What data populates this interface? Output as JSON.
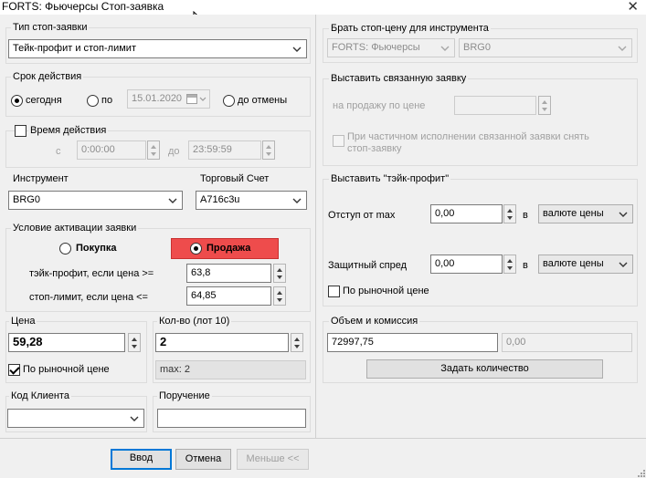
{
  "window": {
    "title": "FORTS: Фьючерсы Стоп-заявка",
    "close_glyph": "✕"
  },
  "order_type": {
    "legend": "Тип стоп-заявки",
    "value": "Тейк-профит и стоп-лимит"
  },
  "validity": {
    "legend": "Срок действия",
    "today_label": "сегодня",
    "until_label": "по",
    "date_value": "15.01.2020",
    "until_cancel_label": "до отмены",
    "selected": "today"
  },
  "time_window": {
    "legend": "Время действия",
    "checked": false,
    "from_label": "с",
    "from_value": "0:00:00",
    "to_label": "до",
    "to_value": "23:59:59"
  },
  "instrument": {
    "legend": "Инструмент",
    "value": "BRG0"
  },
  "account": {
    "legend": "Торговый Счет",
    "value": "A716c3u"
  },
  "activation": {
    "legend": "Условие активации заявки",
    "buy_label": "Покупка",
    "sell_label": "Продажа",
    "selected": "sell",
    "take_profit_label": "тэйк-профит, если цена >=",
    "take_profit_value": "63,8",
    "stop_limit_label": "стоп-лимит, если цена <=",
    "stop_limit_value": "64,85"
  },
  "price": {
    "legend": "Цена",
    "value": "59,28",
    "market_label": "По рыночной цене",
    "market_checked": true
  },
  "quantity": {
    "legend": "Кол-во (лот 10)",
    "value": "2",
    "max_text": "max: 2"
  },
  "client_code": {
    "legend": "Код Клиента",
    "value": ""
  },
  "instruction": {
    "legend": "Поручение",
    "value": ""
  },
  "stop_price_source": {
    "legend": "Брать стоп-цену для инструмента",
    "class_value": "FORTS: Фьючерсы",
    "instrument_value": "BRG0"
  },
  "linked_order": {
    "legend": "Выставить связанную заявку",
    "sell_price_label": "на продажу по цене",
    "sell_price_value": "",
    "partial_label_line1": "При частичном исполнении связанной заявки снять",
    "partial_label_line2": "стоп-заявку"
  },
  "take_profit": {
    "legend": "Выставить \"тэйк-профит\"",
    "offset_label": "Отступ от max",
    "offset_value": "0,00",
    "offset_unit_prefix": "в",
    "offset_unit": "валюте цены",
    "spread_label": "Защитный спред",
    "spread_value": "0,00",
    "spread_unit_prefix": "в",
    "spread_unit": "валюте цены",
    "market_label": "По рыночной цене",
    "market_checked": false
  },
  "volume": {
    "legend": "Объем и комиссия",
    "volume_value": "72997,75",
    "commission_value": "0,00",
    "set_quantity_label": "Задать количество"
  },
  "buttons": {
    "ok": "Ввод",
    "cancel": "Отмена",
    "less": "Меньше <<"
  }
}
